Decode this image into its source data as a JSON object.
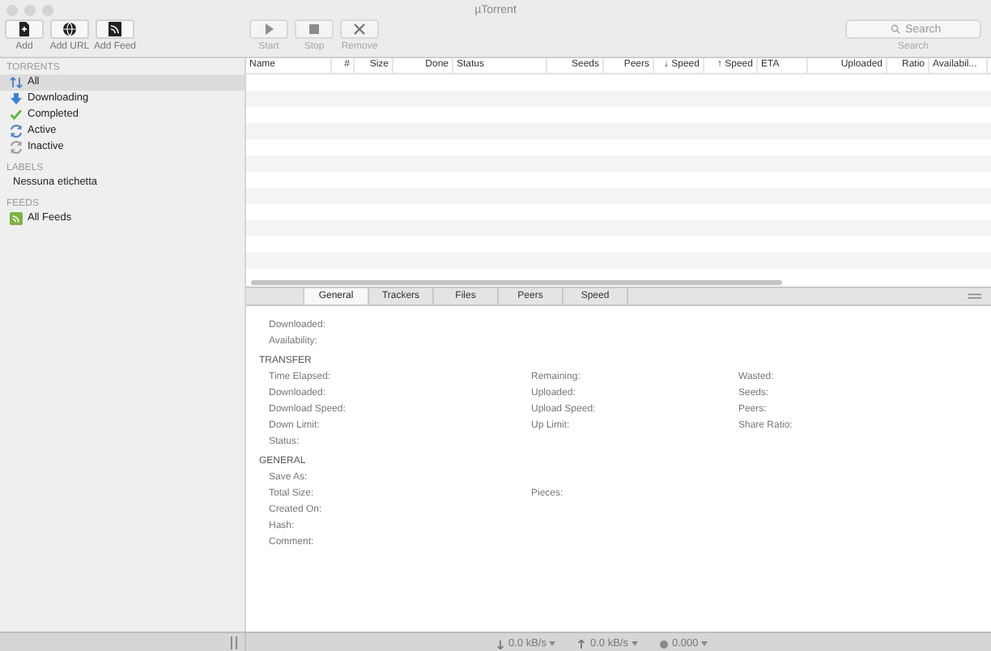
{
  "window": {
    "title": "µTorrent"
  },
  "toolbar": [
    {
      "label": "Add",
      "disabled": false
    },
    {
      "label": "Add URL",
      "disabled": false
    },
    {
      "label": "Add Feed",
      "disabled": false
    },
    {
      "label": "Start",
      "disabled": true
    },
    {
      "label": "Stop",
      "disabled": true
    },
    {
      "label": "Remove",
      "disabled": true
    }
  ],
  "search": {
    "placeholder": "Search",
    "label": "Search"
  },
  "sidebar": [
    {
      "heading": "TORRENTS",
      "items": [
        {
          "label": "All",
          "selected": true
        },
        {
          "label": "Downloading",
          "selected": false
        },
        {
          "label": "Completed",
          "selected": false
        },
        {
          "label": "Active",
          "selected": false
        },
        {
          "label": "Inactive",
          "selected": false
        }
      ]
    },
    {
      "heading": "LABELS",
      "items": [
        {
          "label": "Nessuna etichetta",
          "selected": false
        }
      ]
    },
    {
      "heading": "FEEDS",
      "items": [
        {
          "label": "All Feeds",
          "selected": false
        }
      ]
    }
  ],
  "table": {
    "columns": [
      "Name",
      "#",
      "Size",
      "Done",
      "Status",
      "Seeds",
      "Peers",
      "↓ Speed",
      "↑ Speed",
      "ETA",
      "Uploaded",
      "Ratio",
      "Availabil..."
    ]
  },
  "tabs": [
    {
      "label": "General",
      "selected": true
    },
    {
      "label": "Trackers",
      "selected": false
    },
    {
      "label": "Files",
      "selected": false
    },
    {
      "label": "Peers",
      "selected": false
    },
    {
      "label": "Speed",
      "selected": false
    }
  ],
  "details": [
    {
      "rows": [
        [
          "Downloaded:"
        ],
        [
          "Availability:"
        ]
      ]
    },
    {
      "heading": "TRANSFER",
      "rows": [
        [
          "Time Elapsed:",
          "Remaining:",
          "Wasted:"
        ],
        [
          "Downloaded:",
          "Uploaded:",
          "Seeds:"
        ],
        [
          "Download Speed:",
          "Upload Speed:",
          "Peers:"
        ],
        [
          "Down Limit:",
          "Up Limit:",
          "Share Ratio:"
        ],
        [
          "Status:"
        ]
      ]
    },
    {
      "heading": "GENERAL",
      "rows": [
        [
          "Save As:"
        ],
        [
          "Total Size:",
          "Pieces:"
        ],
        [
          "Created On:"
        ],
        [
          "Hash:"
        ],
        [
          "Comment:"
        ]
      ]
    }
  ],
  "status_bar": [
    "0.0 kB/s",
    "0.0 kB/s",
    "0.000"
  ]
}
